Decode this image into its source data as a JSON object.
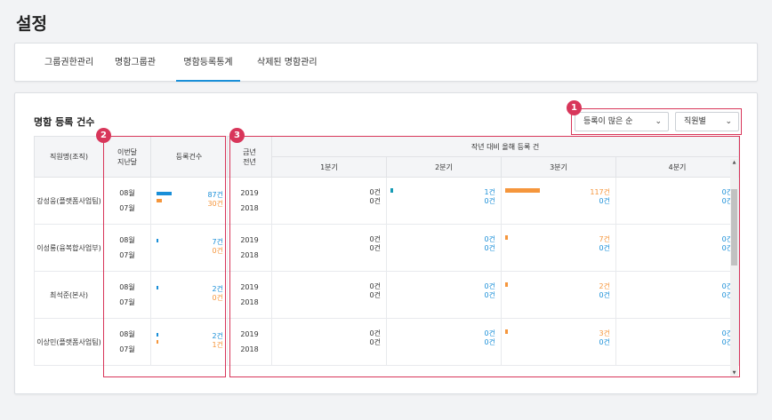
{
  "page": {
    "title": "설정"
  },
  "tabs": [
    {
      "label": "그룹권한관리"
    },
    {
      "label": "명함그룹관리"
    },
    {
      "label": "명함등록통계"
    },
    {
      "label": "삭제된 명함관리"
    }
  ],
  "section": {
    "title": "명함 등록 건수"
  },
  "filters": {
    "sort": "등록이 많은 순",
    "group": "직원별"
  },
  "markers": [
    "1",
    "2",
    "3"
  ],
  "headers": {
    "name": "직원명(조직)",
    "month_line1": "이번달",
    "month_line2": "지난달",
    "count": "등록건수",
    "year_line1": "금년",
    "year_line2": "전년",
    "compare": "작년 대비 올해 등록 건",
    "quarters": [
      "1분기",
      "2분기",
      "3분기",
      "4분기"
    ]
  },
  "colors": {
    "accent": "#1a8fd8",
    "current": "#1a8fd8",
    "previous": "#f5963c",
    "marker": "#d8365a"
  },
  "rows": [
    {
      "name": "강성웅(플랫폼사업팀)",
      "months": [
        "08월",
        "07월"
      ],
      "counts": [
        "87건",
        "30건"
      ],
      "count_values": [
        87,
        30
      ],
      "years": [
        "2019",
        "2018"
      ],
      "quarters": [
        {
          "vals": [
            "0건",
            "0건"
          ],
          "values": [
            0,
            0
          ]
        },
        {
          "vals": [
            "1건",
            "0건"
          ],
          "values": [
            1,
            0
          ]
        },
        {
          "vals": [
            "117건",
            "0건"
          ],
          "values": [
            117,
            0
          ]
        },
        {
          "vals": [
            "0건",
            "0건"
          ],
          "values": [
            0,
            0
          ]
        }
      ]
    },
    {
      "name": "이성룡(융복합사업부)",
      "months": [
        "08월",
        "07월"
      ],
      "counts": [
        "7건",
        "0건"
      ],
      "count_values": [
        7,
        0
      ],
      "years": [
        "2019",
        "2018"
      ],
      "quarters": [
        {
          "vals": [
            "0건",
            "0건"
          ],
          "values": [
            0,
            0
          ]
        },
        {
          "vals": [
            "0건",
            "0건"
          ],
          "values": [
            0,
            0
          ]
        },
        {
          "vals": [
            "7건",
            "0건"
          ],
          "values": [
            7,
            0
          ]
        },
        {
          "vals": [
            "0건",
            "0건"
          ],
          "values": [
            0,
            0
          ]
        }
      ]
    },
    {
      "name": "최석준(본사)",
      "months": [
        "08월",
        "07월"
      ],
      "counts": [
        "2건",
        "0건"
      ],
      "count_values": [
        2,
        0
      ],
      "years": [
        "2019",
        "2018"
      ],
      "quarters": [
        {
          "vals": [
            "0건",
            "0건"
          ],
          "values": [
            0,
            0
          ]
        },
        {
          "vals": [
            "0건",
            "0건"
          ],
          "values": [
            0,
            0
          ]
        },
        {
          "vals": [
            "2건",
            "0건"
          ],
          "values": [
            2,
            0
          ]
        },
        {
          "vals": [
            "0건",
            "0건"
          ],
          "values": [
            0,
            0
          ]
        }
      ]
    },
    {
      "name": "이상민(플랫폼사업팀)",
      "months": [
        "08월",
        "07월"
      ],
      "counts": [
        "2건",
        "1건"
      ],
      "count_values": [
        2,
        1
      ],
      "years": [
        "2019",
        "2018"
      ],
      "quarters": [
        {
          "vals": [
            "0건",
            "0건"
          ],
          "values": [
            0,
            0
          ]
        },
        {
          "vals": [
            "0건",
            "0건"
          ],
          "values": [
            0,
            0
          ]
        },
        {
          "vals": [
            "3건",
            "0건"
          ],
          "values": [
            3,
            0
          ]
        },
        {
          "vals": [
            "0건",
            "0건"
          ],
          "values": [
            0,
            0
          ]
        }
      ]
    }
  ]
}
